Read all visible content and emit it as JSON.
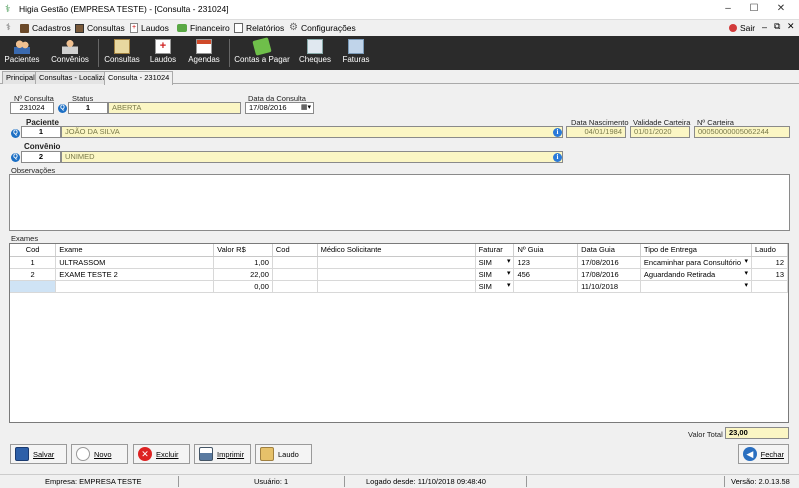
{
  "window": {
    "title": "Higia Gestão (EMPRESA TESTE) - [Consulta - 231024]",
    "minimize": "–",
    "maximize": "☐",
    "close": "✕"
  },
  "menu": {
    "items": [
      {
        "label": "Cadastros",
        "icon": "cadastros-icon"
      },
      {
        "label": "Consultas",
        "icon": "consultas-icon"
      },
      {
        "label": "Laudos",
        "icon": "laudos-icon"
      },
      {
        "label": "Financeiro",
        "icon": "financeiro-icon"
      },
      {
        "label": "Relatórios",
        "icon": "relatorios-icon"
      },
      {
        "label": "Configurações",
        "icon": "configuracoes-icon"
      }
    ],
    "sair": "Sair"
  },
  "toolbar": {
    "pacientes": "Pacientes",
    "convenios": "Convênios",
    "consultas": "Consultas",
    "laudos": "Laudos",
    "agendas": "Agendas",
    "contas": "Contas a Pagar",
    "cheques": "Cheques",
    "faturas": "Faturas"
  },
  "tabs": [
    "Principal",
    "Consultas - Localizar",
    "Consulta - 231024"
  ],
  "form": {
    "num_consulta_label": "Nº Consulta",
    "num_consulta": "231024",
    "status_label": "Status",
    "status_code": "1",
    "status_text": "ABERTA",
    "data_label": "Data da Consulta",
    "data": "17/08/2016",
    "paciente_label": "Paciente",
    "paciente_code": "1",
    "paciente_nome": "JOÃO DA SILVA",
    "nasc_label": "Data Nascimento",
    "nasc": "04/01/1984",
    "validade_label": "Validade Carteira",
    "validade": "01/01/2020",
    "carteira_label": "Nº Carteira",
    "carteira": "00050000005062244",
    "convenio_label": "Convênio",
    "convenio_code": "2",
    "convenio_nome": "UNIMED",
    "obs_label": "Observações",
    "exames_label": "Exames"
  },
  "exames": {
    "headers": [
      "Cod",
      "Exame",
      "Valor R$",
      "Cod",
      "Médico Solicitante",
      "Faturar",
      "Nº Guia",
      "Data Guia",
      "Tipo de Entrega",
      "Laudo"
    ],
    "rows": [
      {
        "cod": "1",
        "exame": "ULTRASSOM",
        "valor": "1,00",
        "cod2": "",
        "medico": "",
        "faturar": "SIM",
        "guia": "123",
        "data_guia": "17/08/2016",
        "entrega": "Encaminhar para Consultório",
        "laudo": "12"
      },
      {
        "cod": "2",
        "exame": "EXAME TESTE 2",
        "valor": "22,00",
        "cod2": "",
        "medico": "",
        "faturar": "SIM",
        "guia": "456",
        "data_guia": "17/08/2016",
        "entrega": "Aguardando Retirada",
        "laudo": "13"
      },
      {
        "cod": "",
        "exame": "",
        "valor": "0,00",
        "cod2": "",
        "medico": "",
        "faturar": "SIM",
        "guia": "",
        "data_guia": "11/10/2018",
        "entrega": "",
        "laudo": ""
      }
    ]
  },
  "total": {
    "label": "Valor Total",
    "value": "23,00"
  },
  "buttons": {
    "salvar": "Salvar",
    "novo": "Novo",
    "excluir": "Excluir",
    "imprimir": "Imprimir",
    "laudo": "Laudo",
    "fechar": "Fechar"
  },
  "status": {
    "empresa": "Empresa: EMPRESA TESTE",
    "usuario": "Usuário: 1",
    "logado": "Logado desde: 11/10/2018 09:48:40",
    "versao": "Versão: 2.0.13.58"
  }
}
